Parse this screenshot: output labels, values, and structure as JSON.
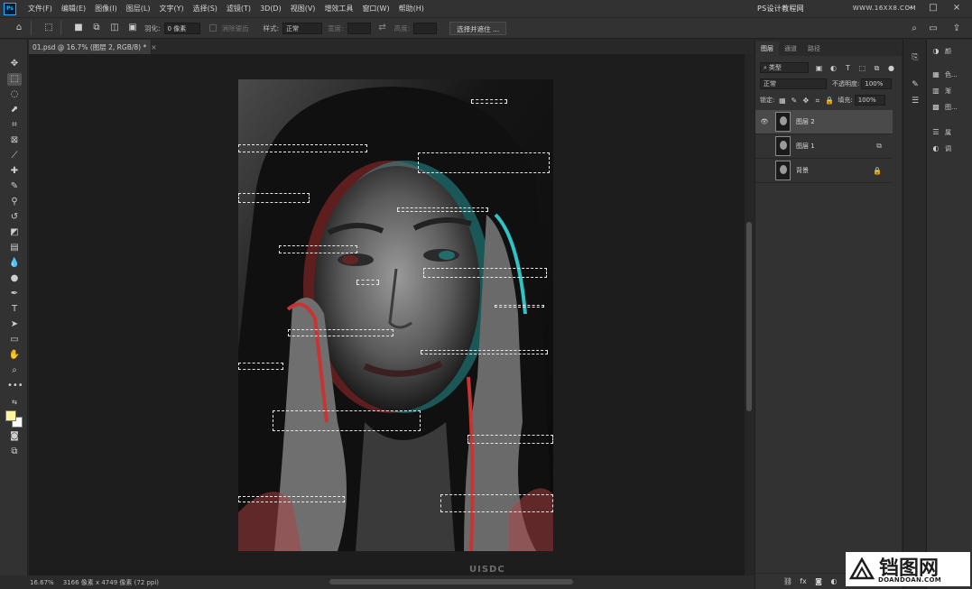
{
  "menu": {
    "app_logo": "Ps",
    "items": [
      "文件(F)",
      "编辑(E)",
      "图像(I)",
      "图层(L)",
      "文字(Y)",
      "选择(S)",
      "滤镜(T)",
      "3D(D)",
      "视图(V)",
      "增效工具",
      "窗口(W)",
      "帮助(H)"
    ],
    "watermark": "PS设计教程网",
    "watermark_url": "WWW.16XX8.COM"
  },
  "options": {
    "feather_label": "羽化:",
    "feather_value": "0 像素",
    "antialias_label": "消除锯齿",
    "style_label": "样式:",
    "style_value": "正常",
    "width_label": "宽度:",
    "height_label": "高度:",
    "select_mask_button": "选择并遮住 ..."
  },
  "document": {
    "tab_title": "01.psd @ 16.7% (图层 2, RGB/8) *",
    "close_glyph": "×"
  },
  "status": {
    "zoom": "16.67%",
    "doc_info": "3166 像素 x 4749 像素 (72 ppi)",
    "watermark": "UISDC"
  },
  "layers_panel": {
    "tabs": [
      "图层",
      "通道",
      "路径"
    ],
    "filter_kind": "类型",
    "blend_mode": "正常",
    "opacity_label": "不透明度:",
    "opacity_value": "100%",
    "lock_label": "锁定:",
    "fill_label": "填充:",
    "fill_value": "100%",
    "layers": [
      {
        "name": "图层 2",
        "visible": true,
        "selected": true,
        "badge": ""
      },
      {
        "name": "图层 1",
        "visible": false,
        "selected": false,
        "badge": "⧉"
      },
      {
        "name": "背景",
        "visible": false,
        "selected": false,
        "badge": "🔒"
      }
    ]
  },
  "mini_panels": {
    "items": [
      "颜",
      "色...",
      "渐",
      "图...",
      "属",
      "调"
    ]
  },
  "brand": {
    "name": "铛图网",
    "url": "DOANDOAN.COM"
  },
  "colors": {
    "foreground": "#fff3a0",
    "background": "#ffffff",
    "app_bg": "#323232",
    "pasteboard": "#1d1d1d"
  }
}
